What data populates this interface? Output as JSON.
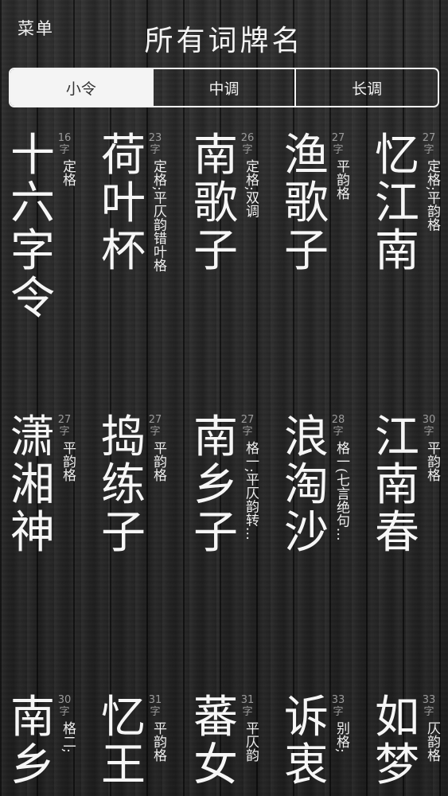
{
  "header": {
    "menu_label": "菜单",
    "title": "所有词牌名"
  },
  "tabs": [
    {
      "label": "小令",
      "active": true
    },
    {
      "label": "中调",
      "active": false
    },
    {
      "label": "长调",
      "active": false
    }
  ],
  "poems": [
    {
      "name": "十六字令",
      "count": "16",
      "unit": "字",
      "format": "定格"
    },
    {
      "name": "荷叶杯",
      "count": "23",
      "unit": "字",
      "format": "定格;平仄韵错叶格"
    },
    {
      "name": "南歌子",
      "count": "26",
      "unit": "字",
      "format": "定格;双调"
    },
    {
      "name": "渔歌子",
      "count": "27",
      "unit": "字",
      "format": "平韵格"
    },
    {
      "name": "忆江南",
      "count": "27",
      "unit": "字",
      "format": "定格;平韵格"
    },
    {
      "name": "潇湘神",
      "count": "27",
      "unit": "字",
      "format": "平韵格"
    },
    {
      "name": "捣练子",
      "count": "27",
      "unit": "字",
      "format": "平韵格"
    },
    {
      "name": "南乡子",
      "count": "27",
      "unit": "字",
      "format": "格一;平仄韵转…"
    },
    {
      "name": "浪淘沙",
      "count": "28",
      "unit": "字",
      "format": "格一(七言绝句…"
    },
    {
      "name": "江南春",
      "count": "30",
      "unit": "字",
      "format": "平韵格"
    },
    {
      "name": "南乡",
      "count": "30",
      "unit": "字",
      "format": "格二;"
    },
    {
      "name": "忆王",
      "count": "31",
      "unit": "字",
      "format": "平韵格"
    },
    {
      "name": "蕃女",
      "count": "31",
      "unit": "字",
      "format": "平仄韵"
    },
    {
      "name": "诉衷",
      "count": "33",
      "unit": "字",
      "format": "别格;"
    },
    {
      "name": "如梦",
      "count": "33",
      "unit": "字",
      "format": "仄韵格"
    }
  ]
}
